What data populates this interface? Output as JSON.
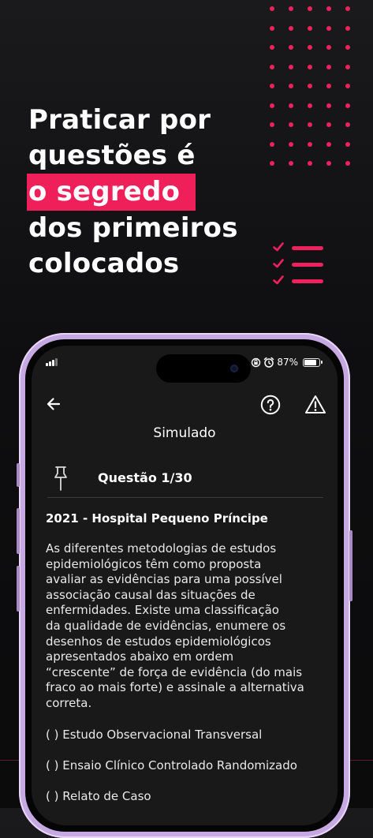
{
  "promo": {
    "headline_lines": [
      "Praticar por",
      "questões é",
      "o segredo",
      "dos primeiros",
      "colocados"
    ],
    "accent_color": "#ef1f5a",
    "decoration_icon": "checklist-icon"
  },
  "status_bar": {
    "battery": "87%",
    "icons": [
      "signal-icon",
      "screen-lock-icon",
      "alarm-icon",
      "battery-icon"
    ]
  },
  "app": {
    "title": "Simulado",
    "nav_icons": [
      "back-arrow-icon",
      "help-icon",
      "report-warning-icon"
    ],
    "question": {
      "pin_icon": "pin-icon",
      "label": "Questão 1/30",
      "source": "2021 - Hospital Pequeno Príncipe",
      "body_lines": [
        "As diferentes metodologias de estudos",
        "epidemiológicos têm como proposta",
        "avaliar as evidências para uma possível",
        "associação causal das situações de",
        "enfermidades. Existe uma classificação",
        "da qualidade de evidências, enumere os",
        "desenhos de estudos epidemiológicos",
        "apresentados abaixo em ordem",
        "“crescente” de força de evidência (do mais",
        "fraco ao mais forte) e assinale a alternativa",
        "correta."
      ],
      "options": [
        "( ) Estudo Observacional Transversal",
        "( ) Ensaio Clínico Controlado Randomizado",
        "( ) Relato de Caso"
      ]
    }
  }
}
